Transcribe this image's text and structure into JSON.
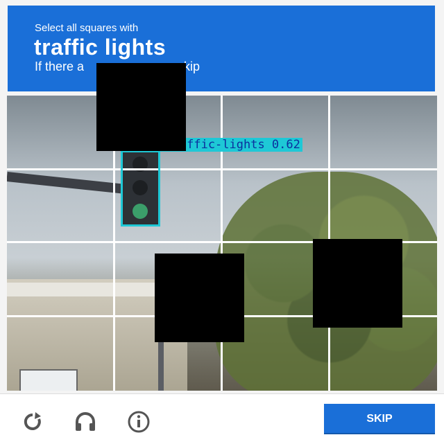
{
  "header": {
    "line1": "Select all squares with",
    "line2": "traffic lights",
    "line3": "If there a"
  },
  "header_tail": "skip",
  "detection": {
    "label": "green-traffic-lights 0.62"
  },
  "footer": {
    "reload_icon": "reload-icon",
    "audio_icon": "headphones-icon",
    "info_icon": "info-icon",
    "skip_label": "SKIP"
  },
  "colors": {
    "header_bg": "#1a6fd8",
    "bbox": "#1ec8d6",
    "button_bg": "#1a6fd8"
  }
}
